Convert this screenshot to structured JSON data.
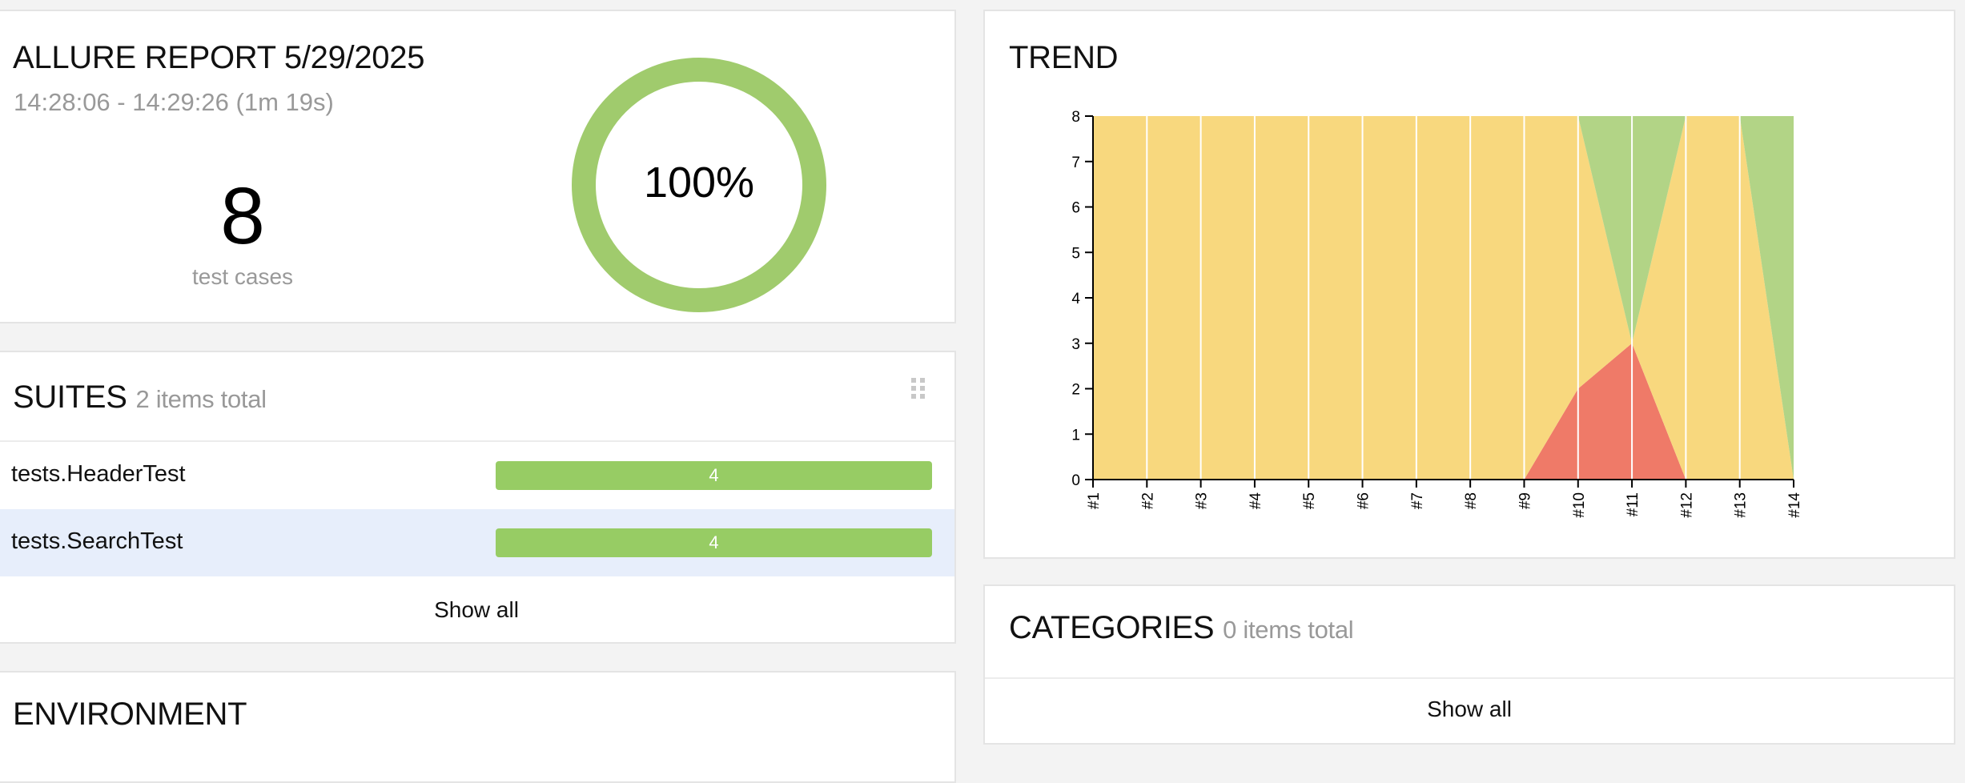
{
  "summary": {
    "title": "ALLURE REPORT 5/29/2025",
    "time_range": "14:28:06 - 14:29:26 (1m 19s)",
    "test_count": "8",
    "test_count_label": "test cases",
    "success_rate": "100%"
  },
  "suites": {
    "title": "SUITES",
    "subtitle": "2 items total",
    "items": [
      {
        "name": "tests.HeaderTest",
        "count": "4"
      },
      {
        "name": "tests.SearchTest",
        "count": "4"
      }
    ],
    "show_all": "Show all"
  },
  "environment": {
    "title": "ENVIRONMENT"
  },
  "trend": {
    "title": "TREND"
  },
  "categories": {
    "title": "CATEGORIES",
    "subtitle": "0 items total",
    "show_all": "Show all"
  },
  "colors": {
    "passed": "#97cc64",
    "failed": "#fd5a3e",
    "broken": "#ffd050",
    "trend_passed": "#b2d486",
    "trend_failed": "#ef7a68",
    "trend_broken": "#f8d87e"
  },
  "chart_data": {
    "type": "area",
    "x": [
      "#1",
      "#2",
      "#3",
      "#4",
      "#5",
      "#6",
      "#7",
      "#8",
      "#9",
      "#10",
      "#11",
      "#12",
      "#13",
      "#14"
    ],
    "ylim": [
      0,
      8
    ],
    "yticks": [
      0,
      1,
      2,
      3,
      4,
      5,
      6,
      7,
      8
    ],
    "series": [
      {
        "key": "failed",
        "values": [
          0,
          0,
          0,
          0,
          0,
          0,
          0,
          0,
          0,
          2,
          3,
          0,
          0,
          0
        ]
      },
      {
        "key": "broken",
        "values": [
          8,
          8,
          8,
          8,
          8,
          8,
          8,
          8,
          8,
          6,
          0,
          8,
          8,
          0
        ]
      },
      {
        "key": "passed",
        "values": [
          0,
          0,
          0,
          0,
          0,
          0,
          0,
          0,
          0,
          0,
          5,
          0,
          0,
          8
        ]
      }
    ]
  }
}
